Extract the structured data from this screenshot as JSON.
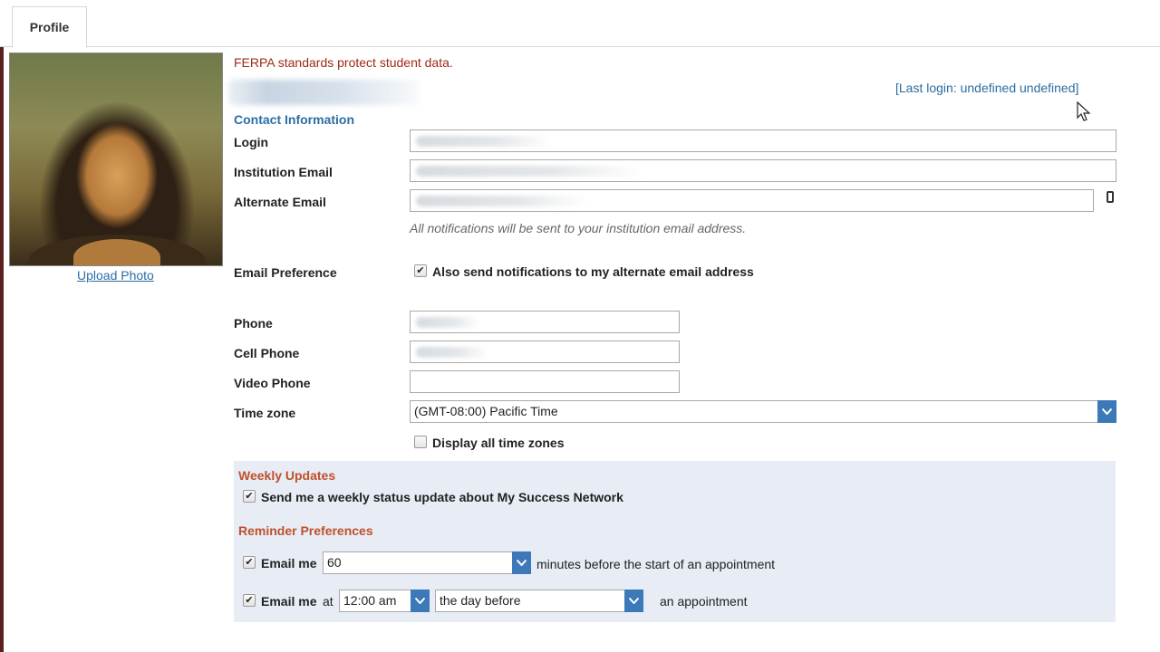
{
  "tabs": [
    {
      "label": "Profile"
    }
  ],
  "profile": {
    "upload_photo_label": "Upload Photo",
    "ferpa_notice": "FERPA standards protect student data.",
    "last_login": "[Last login: undefined undefined]"
  },
  "contact": {
    "heading": "Contact Information",
    "login_label": "Login",
    "institution_email_label": "Institution Email",
    "alternate_email_label": "Alternate Email",
    "notifications_hint": "All notifications will be sent to your institution email address.",
    "email_pref_label": "Email Preference",
    "email_pref_checkbox_label": "Also send notifications to my alternate email address",
    "email_pref_checked": true,
    "phone_label": "Phone",
    "cell_phone_label": "Cell Phone",
    "video_phone_label": "Video Phone",
    "timezone_label": "Time zone",
    "timezone_value": "(GMT-08:00) Pacific Time",
    "display_all_tz_label": "Display all time zones",
    "display_all_tz_checked": false
  },
  "weekly": {
    "heading": "Weekly Updates",
    "checkbox_label": "Send me a weekly status update about My Success Network",
    "checked": true
  },
  "reminders": {
    "heading": "Reminder Preferences",
    "email_me_label": "Email me",
    "minutes_value": "60",
    "minutes_suffix": "minutes before the start of an appointment",
    "at_label": "at",
    "time_value": "12:00 am",
    "day_value": "the day before",
    "appointment_suffix": "an appointment",
    "row1_checked": true,
    "row2_checked": true
  },
  "colors": {
    "link": "#2a6ea5",
    "notice": "#9c2b12",
    "section_heading": "#c0502a",
    "select_arrow": "#3d79b8",
    "panel_bg": "#e7ecf5"
  }
}
